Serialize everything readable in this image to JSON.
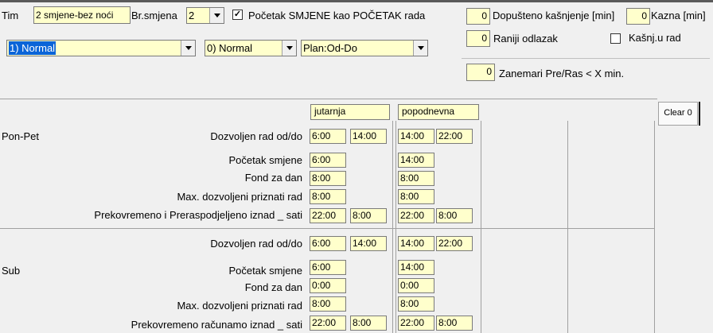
{
  "header": {
    "tim_label": "Tim",
    "tim_value": "2 smjene-bez noći",
    "br_smjena_label": "Br.smjena",
    "br_smjena_value": "2",
    "pocetak_checkbox_label": "Početak SMJENE kao POČETAK rada",
    "pocetak_checked": true,
    "combo1_value": "1) Normal",
    "combo2_value": "0) Normal",
    "combo3_value": "Plan:Od-Do"
  },
  "right_panel": {
    "dopusteno_value": "0",
    "dopusteno_label": "Dopušteno kašnjenje [min]",
    "kazna_value": "0",
    "kazna_label": "Kazna [min]",
    "raniji_value": "0",
    "raniji_label": "Raniji odlazak",
    "kasnj_label": "Kašnj.u rad",
    "kasnj_checked": false,
    "zanemari_value": "0",
    "zanemari_label": "Zanemari Pre/Ras < X min."
  },
  "grid": {
    "shift1_name": "jutarnja",
    "shift2_name": "popodnevna",
    "clear_label": "Clear 0",
    "sections": [
      {
        "day": "Pon-Pet",
        "rows": [
          {
            "label": "Dozvoljen rad od/do",
            "s1": [
              "6:00",
              "14:00"
            ],
            "s2": [
              "14:00",
              "22:00"
            ]
          },
          {
            "label": "Početak smjene",
            "s1": [
              "6:00"
            ],
            "s2": [
              "14:00"
            ]
          },
          {
            "label": "Fond za dan",
            "s1": [
              "8:00"
            ],
            "s2": [
              "8:00"
            ]
          },
          {
            "label": "Max. dozvoljeni priznati rad",
            "s1": [
              "8:00"
            ],
            "s2": [
              "8:00"
            ]
          },
          {
            "label": "Prekovremeno i Preraspodjeljeno iznad _ sati",
            "s1": [
              "22:00",
              "8:00"
            ],
            "s2": [
              "22:00",
              "8:00"
            ]
          }
        ]
      },
      {
        "day": "Sub",
        "rows": [
          {
            "label": "Dozvoljen rad od/do",
            "s1": [
              "6:00",
              "14:00"
            ],
            "s2": [
              "14:00",
              "22:00"
            ]
          },
          {
            "label": "Početak smjene",
            "s1": [
              "6:00"
            ],
            "s2": [
              "14:00"
            ]
          },
          {
            "label": "Fond za dan",
            "s1": [
              "0:00"
            ],
            "s2": [
              "0:00"
            ]
          },
          {
            "label": "Max. dozvoljeni priznati rad",
            "s1": [
              "8:00"
            ],
            "s2": [
              "8:00"
            ]
          },
          {
            "label": "Prekovremeno računamo iznad _ sati",
            "s1": [
              "22:00",
              "8:00"
            ],
            "s2": [
              "22:00",
              "8:00"
            ]
          }
        ]
      }
    ]
  }
}
